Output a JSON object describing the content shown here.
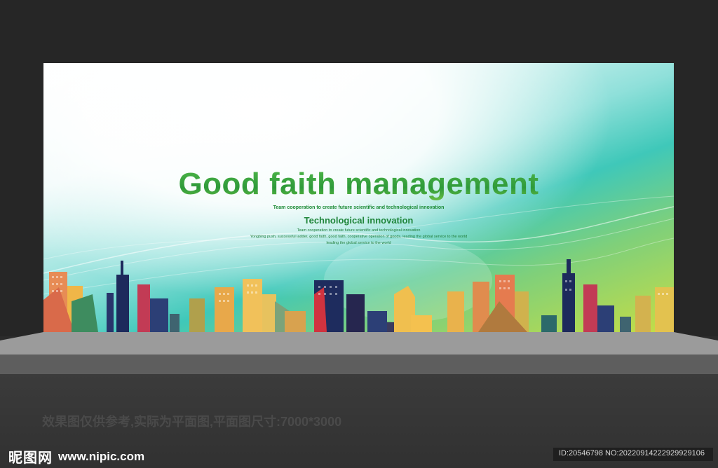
{
  "board": {
    "headline": "Good faith management",
    "tagline": "Team cooperation to create future scientific and technological innovation",
    "subheading": "Technological innovation",
    "small_lines": [
      "Team cooperation to create future scientific and technological innovation",
      "Yongbing push, successful ladder, good faith, good faith, cooperative operation of goods, leading the global service to the world",
      "leading the global service to the world"
    ]
  },
  "footer": {
    "note": "效果图仅供参考,实际为平面图,平面图尺寸:7000*3000",
    "brand_cn": "昵图网",
    "brand_url": "www.nipic.com",
    "id_text": "ID:20546798 NO:20220914222929929106"
  },
  "colors": {
    "headline_green": "#3aa83f",
    "sub_green": "#20863b",
    "backdrop": "#262626",
    "stage_floor": "#9b9b9b"
  }
}
